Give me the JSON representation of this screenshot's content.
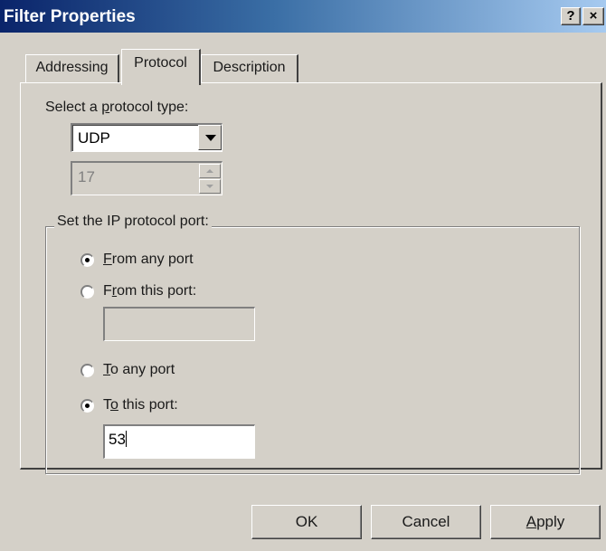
{
  "window": {
    "title": "Filter Properties",
    "help_label": "?",
    "close_label": "×",
    "titlebar_color": "#0a246a",
    "face_color": "#d4d0c8"
  },
  "tabs": [
    {
      "label": "Addressing",
      "active": false
    },
    {
      "label": "Protocol",
      "active": true
    },
    {
      "label": "Description",
      "active": false
    }
  ],
  "protocol": {
    "label_pre": "Select a ",
    "label_key": "p",
    "label_post": "rotocol type:",
    "selected": "UDP",
    "number": "17"
  },
  "port_group": {
    "title": "Set the IP protocol port:",
    "from_any": {
      "key": "F",
      "rest": "rom any port",
      "checked": true
    },
    "from_this": {
      "pre": "F",
      "key": "r",
      "rest": "om this port:",
      "checked": false,
      "value": ""
    },
    "to_any": {
      "key": "T",
      "rest": "o any port",
      "checked": false
    },
    "to_this": {
      "pre": "T",
      "key": "o",
      "rest": " this port:",
      "checked": true,
      "value": "53"
    }
  },
  "buttons": {
    "ok": "OK",
    "cancel": "Cancel",
    "apply_key": "A",
    "apply_rest": "pply"
  }
}
